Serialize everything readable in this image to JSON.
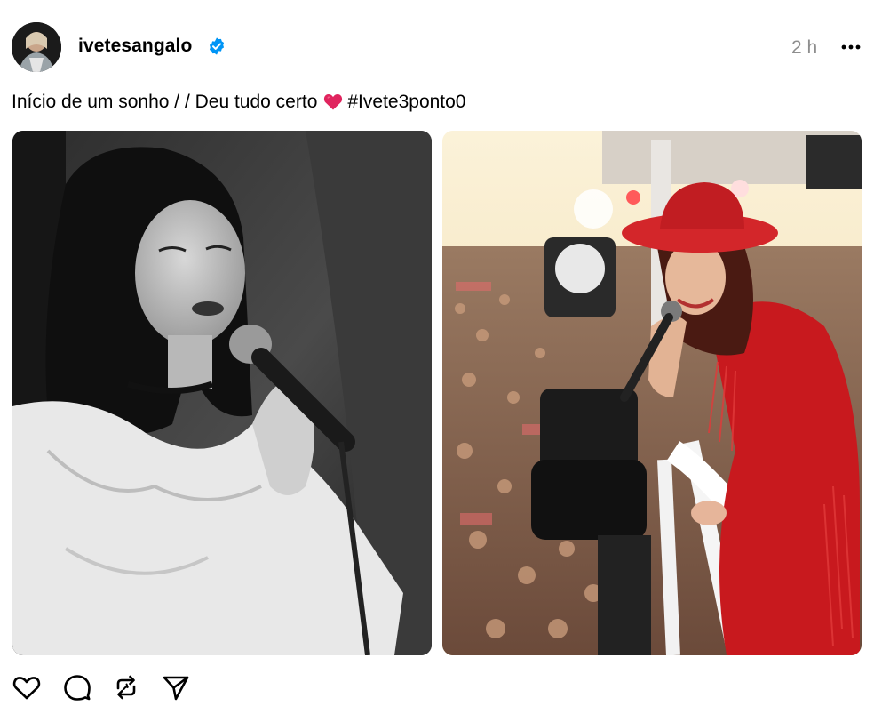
{
  "post": {
    "username": "ivetesangalo",
    "verified": true,
    "timestamp": "2 h",
    "caption_text": "Início de um sonho / / Deu tudo certo",
    "caption_emoji": "red-heart",
    "caption_hashtag": "#Ivete3ponto0"
  },
  "icons": {
    "verified_badge": "verified-badge-icon",
    "more": "more-horizontal-icon",
    "like": "heart-outline-icon",
    "reply": "comment-bubble-icon",
    "repost": "repost-icon",
    "share": "send-icon"
  },
  "media": [
    {
      "kind": "photo",
      "tone": "black-and-white"
    },
    {
      "kind": "photo",
      "tone": "color"
    }
  ],
  "colors": {
    "verified": "#0095f6",
    "timestamp": "#8e8e8e",
    "heart_emoji": "#e0245e"
  }
}
